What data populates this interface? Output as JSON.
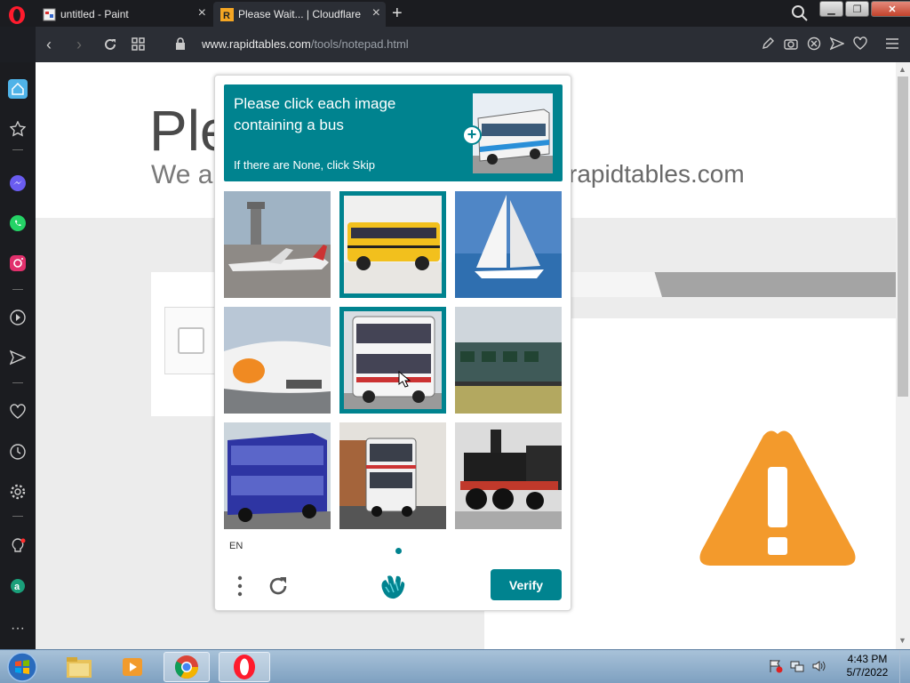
{
  "browser": {
    "tabs": [
      {
        "label": "untitled - Paint"
      },
      {
        "label": "Please Wait... | Cloudflare"
      }
    ],
    "url_domain": "www.rapidtables.com",
    "url_path": "/tools/notepad.html"
  },
  "page": {
    "title_fragment": "Ple",
    "subtitle_fragment": "We ar",
    "subtitle_domain": "rapidtables.com"
  },
  "captcha": {
    "instruction": "Please click each image containing a bus",
    "skip_hint": "If there are None, click Skip",
    "grid": [
      {
        "subject": "airplane-with-tower",
        "selected": false
      },
      {
        "subject": "yellow-school-bus",
        "selected": true
      },
      {
        "subject": "sailboat",
        "selected": false
      },
      {
        "subject": "airplane-closeup",
        "selected": false
      },
      {
        "subject": "white-double-decker-bus",
        "selected": true
      },
      {
        "subject": "train-carriage",
        "selected": false
      },
      {
        "subject": "blue-double-decker-bus",
        "selected": false
      },
      {
        "subject": "white-double-decker-bus-street",
        "selected": false
      },
      {
        "subject": "steam-locomotive",
        "selected": false
      }
    ],
    "language": "EN",
    "verify_label": "Verify",
    "accent_color": "#00838f"
  },
  "taskbar": {
    "time": "4:43 PM",
    "date": "5/7/2022"
  }
}
